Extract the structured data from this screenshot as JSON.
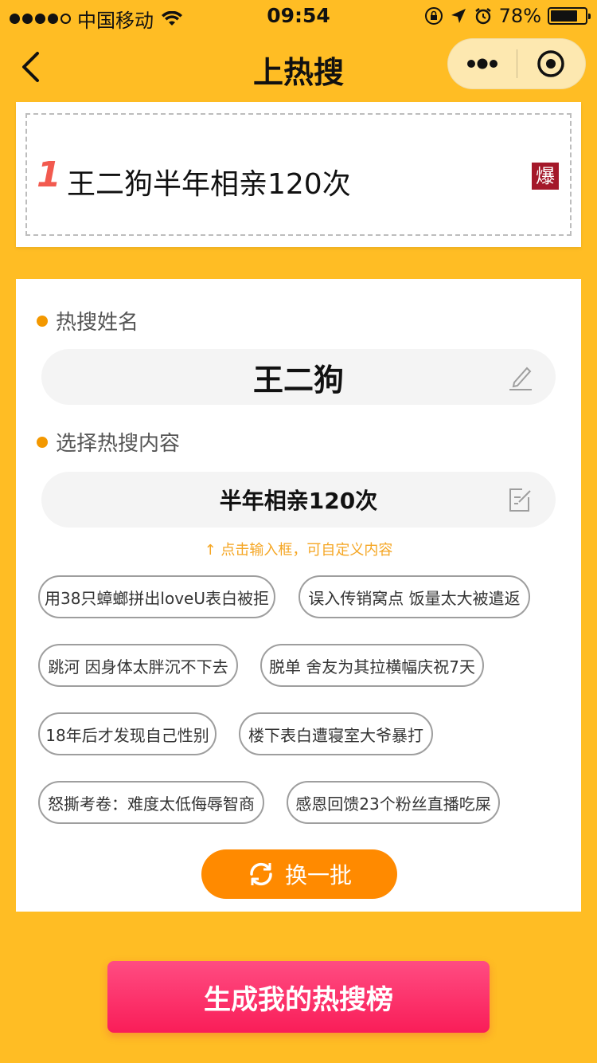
{
  "status_bar": {
    "carrier": "中国移动",
    "time": "09:54",
    "battery_percent": "78%",
    "battery_level": 0.78
  },
  "nav": {
    "title": "上热搜",
    "icons": [
      "back-arrow-icon",
      "more-dots-icon",
      "target-icon"
    ]
  },
  "preview": {
    "rank": "1",
    "text": "王二狗半年相亲120次",
    "badge": "爆"
  },
  "form": {
    "name_label": "热搜姓名",
    "name_value": "王二狗",
    "content_label": "选择热搜内容",
    "content_value": "半年相亲120次",
    "hint": "点击输入框，可自定义内容",
    "tags": [
      "用38只蟑螂拼出loveU表白被拒",
      "误入传销窝点 饭量太大被遣返",
      "跳河 因身体太胖沉不下去",
      "脱单 舍友为其拉横幅庆祝7天",
      "18年后才发现自己性别",
      "楼下表白遭寝室大爷暴打",
      "怒撕考卷：难度太低侮辱智商",
      "感恩回馈23个粉丝直播吃屎"
    ],
    "refresh_label": "换一批"
  },
  "generate_label": "生成我的热搜榜",
  "colors": {
    "background": "#FFBD24",
    "accent_orange": "#FF8A00",
    "generate_pink": "#F91D58",
    "rank_red": "#F25A4F",
    "badge_red": "#A4182A"
  }
}
